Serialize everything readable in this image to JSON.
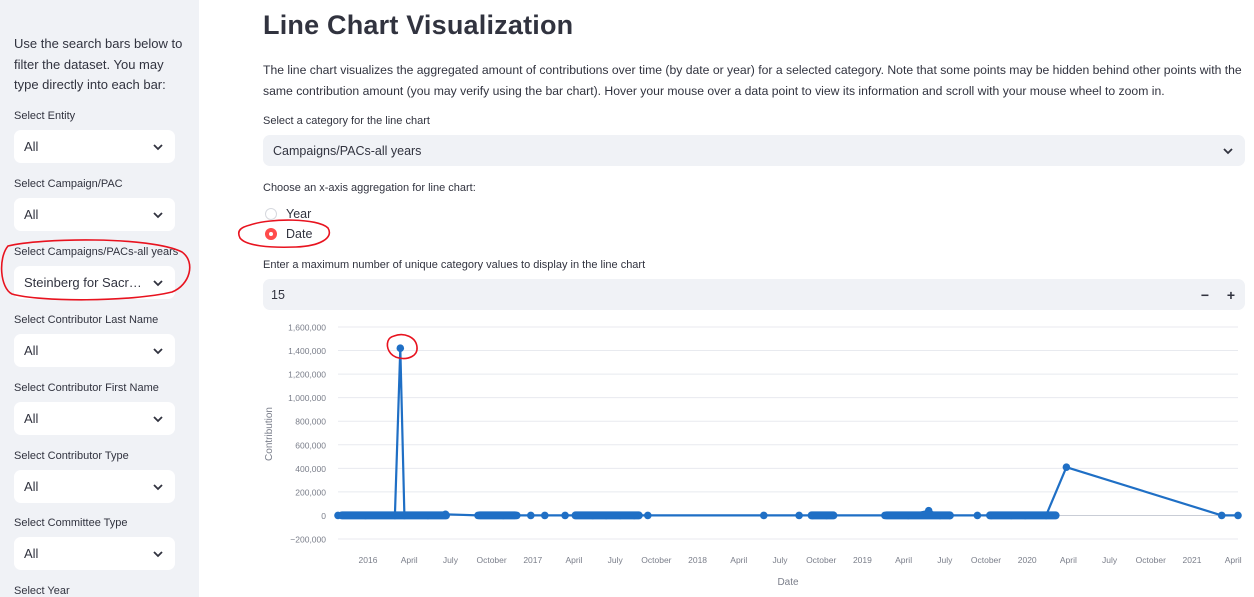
{
  "sidebar": {
    "intro": "Use the search bars below to filter the dataset. You may type directly into each bar:",
    "filters": [
      {
        "label": "Select Entity",
        "value": "All"
      },
      {
        "label": "Select Campaign/PAC",
        "value": "All"
      },
      {
        "label": "Select Campaigns/PACs-all years",
        "value": "Steinberg for Sacramento"
      },
      {
        "label": "Select Contributor Last Name",
        "value": "All"
      },
      {
        "label": "Select Contributor First Name",
        "value": "All"
      },
      {
        "label": "Select Contributor Type",
        "value": "All"
      },
      {
        "label": "Select Committee Type",
        "value": "All"
      }
    ],
    "year_label": "Select Year"
  },
  "main": {
    "title": "Line Chart Visualization",
    "description": "The line chart visualizes the aggregated amount of contributions over time (by date or year) for a selected category. Note that some points may be hidden behind other points with the same contribution amount (you may verify using the bar chart). Hover your mouse over a data point to view its information and scroll with your mouse wheel to zoom in.",
    "category_label": "Select a category for the line chart",
    "category_value": "Campaigns/PACs-all years",
    "aggregation_label": "Choose an x-axis aggregation for line chart:",
    "aggregation_options": [
      "Year",
      "Date"
    ],
    "aggregation_selected": "Date",
    "max_label": "Enter a maximum number of unique category values to display in the line chart",
    "max_value": "15",
    "minus": "−",
    "plus": "+"
  },
  "colors": {
    "accent": "#ff4b4b",
    "series": "#1f6fc5",
    "annotation": "#e8131f"
  },
  "chart_data": {
    "type": "line",
    "xlabel": "Date",
    "ylabel": "Contribution",
    "ylim": [
      -200000,
      1600000
    ],
    "y_ticks": [
      -200000,
      0,
      200000,
      400000,
      600000,
      800000,
      1000000,
      1200000,
      1400000,
      1600000
    ],
    "y_tick_labels": [
      "−200,000",
      "0",
      "200,000",
      "400,000",
      "600,000",
      "800,000",
      "1,000,000",
      "1,200,000",
      "1,400,000",
      "1,600,000"
    ],
    "x_tick_labels": [
      "2016",
      "April",
      "July",
      "October",
      "2017",
      "April",
      "July",
      "October",
      "2018",
      "April",
      "July",
      "October",
      "2019",
      "April",
      "July",
      "October",
      "2020",
      "April",
      "July",
      "October",
      "2021",
      "April"
    ],
    "grid": true,
    "legend": "none",
    "series": [
      {
        "values_note": "",
        "x": [
          "2015-11-15",
          "2016-01-15",
          "2016-03-20",
          "2016-04-01",
          "2016-04-10",
          "2016-06-01",
          "2016-07-10",
          "2016-09-20",
          "2016-11-15",
          "2016-12-15",
          "2017-01-15",
          "2017-02-15",
          "2017-04-01",
          "2017-06-01",
          "2017-07-01",
          "2017-08-01",
          "2017-09-01",
          "2017-10-01",
          "2018-06-15",
          "2018-09-01",
          "2018-10-01",
          "2018-11-01",
          "2019-03-10",
          "2019-05-01",
          "2019-06-15",
          "2019-07-10",
          "2019-08-01",
          "2019-10-01",
          "2019-11-01",
          "2019-12-15",
          "2020-01-15",
          "2020-03-01",
          "2020-04-15",
          "2021-03-25",
          "2021-04-30"
        ],
        "values": [
          0,
          0,
          0,
          1420000,
          0,
          0,
          10000,
          0,
          0,
          0,
          0,
          0,
          0,
          0,
          0,
          0,
          0,
          0,
          0,
          0,
          0,
          0,
          0,
          0,
          40000,
          0,
          0,
          0,
          0,
          0,
          0,
          0,
          410000,
          0,
          0
        ]
      }
    ]
  }
}
